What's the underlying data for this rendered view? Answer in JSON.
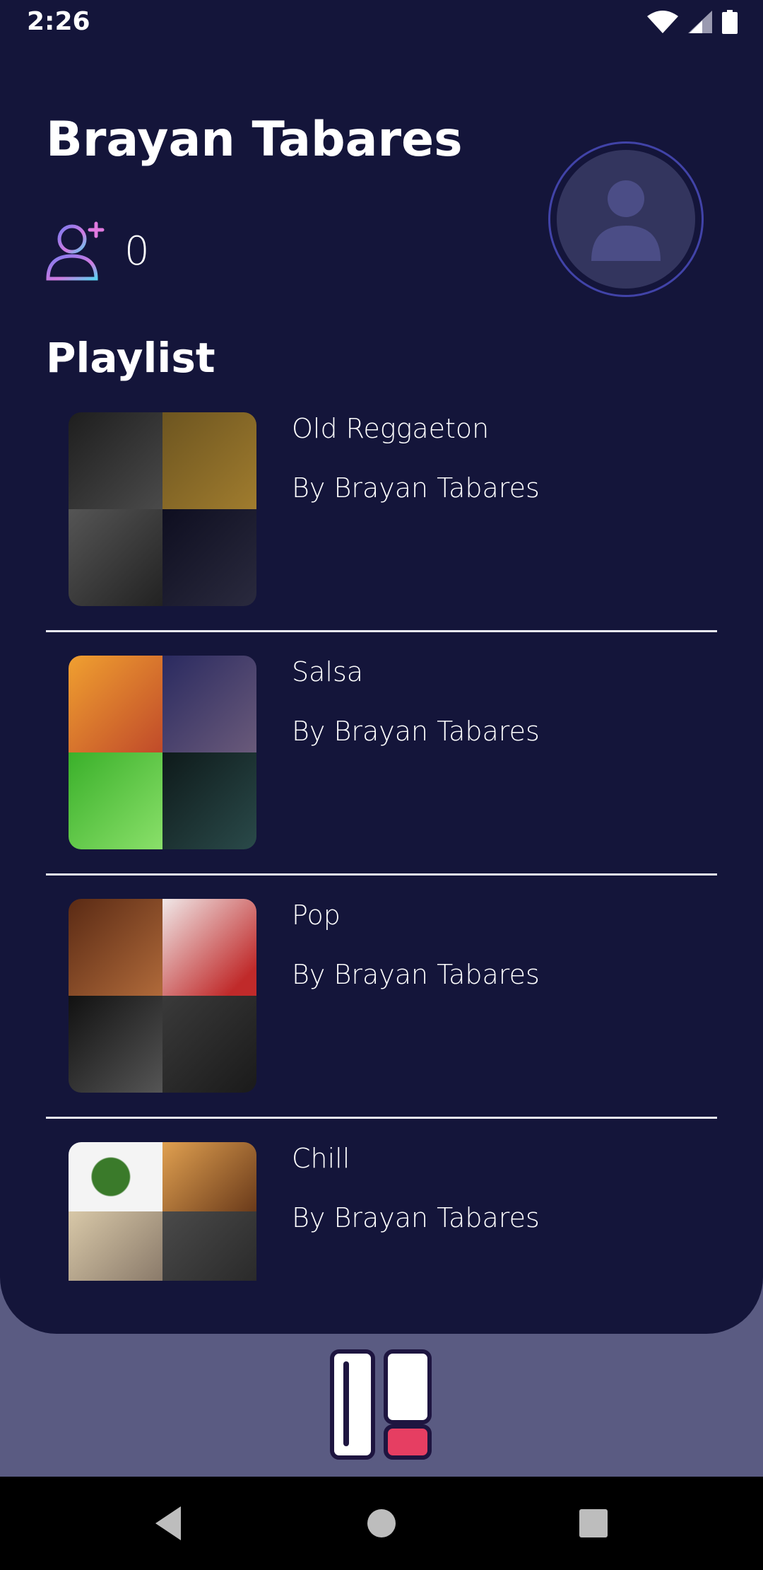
{
  "status_bar": {
    "time": "2:26",
    "icons": [
      "wifi-icon",
      "signal-icon",
      "battery-icon"
    ]
  },
  "profile": {
    "name": "Brayan Tabares",
    "followers_count": "0",
    "follow_icon": "add-friend-icon",
    "avatar_icon": "user-placeholder-icon"
  },
  "playlist_section": {
    "title": "Playlist",
    "items": [
      {
        "title": "Old Reggaeton",
        "author": "By Brayan Tabares",
        "cover_colors": [
          "#2b2b2b",
          "#8a6a22",
          "#3a3a3a",
          "#18182a"
        ]
      },
      {
        "title": "Salsa",
        "author": "By Brayan Tabares",
        "cover_colors": [
          "#e07b2a",
          "#3a3a6a",
          "#4ab83a",
          "#1a2a2a"
        ]
      },
      {
        "title": "Pop",
        "author": "By Brayan Tabares",
        "cover_colors": [
          "#7a3a1a",
          "#e6dede",
          "#2a2a2a",
          "#2e2e2e"
        ]
      },
      {
        "title": "Chill",
        "author": "By Brayan Tabares",
        "cover_colors": [
          "#f2f2f2",
          "#d08a3a",
          "#c9b89a",
          "#3a3a3a"
        ]
      }
    ]
  },
  "bottom_nav": {
    "library_icon": "library-icon"
  },
  "system_nav": {
    "buttons": [
      "back-icon",
      "home-icon",
      "recents-icon"
    ]
  },
  "colors": {
    "panel": "#14153a",
    "background": "#5a5b82",
    "avatar_border": "#4143a8",
    "library_accent": "#e63e62"
  }
}
